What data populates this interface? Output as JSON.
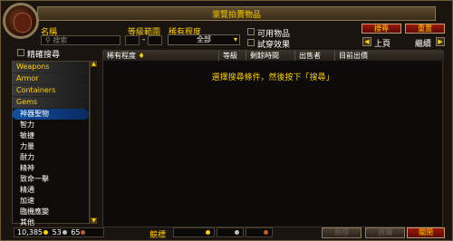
{
  "window": {
    "title": "瀏覽拍賣物品"
  },
  "filters": {
    "name_label": "名稱",
    "search_placeholder": "搜索",
    "level_label": "等級範圍",
    "level_dash": "-",
    "rarity_label": "稀有程度",
    "rarity_value": "全部",
    "usable_label": "可用物品",
    "preview_label": "試穿效果",
    "search_button": "搜尋",
    "reset_button": "重置",
    "prev_label": "上頁",
    "next_label": "繼續",
    "exact_label": "精確搜尋"
  },
  "categories": [
    {
      "label": "Weapons",
      "type": "top",
      "selected": false
    },
    {
      "label": "Armor",
      "type": "top",
      "selected": false
    },
    {
      "label": "Containers",
      "type": "top",
      "selected": false
    },
    {
      "label": "Gems",
      "type": "top",
      "selected": false
    },
    {
      "label": "神器聖物",
      "type": "sub",
      "selected": true
    },
    {
      "label": "智力",
      "type": "sub",
      "selected": false
    },
    {
      "label": "敏捷",
      "type": "sub",
      "selected": false
    },
    {
      "label": "力量",
      "type": "sub",
      "selected": false
    },
    {
      "label": "耐力",
      "type": "sub",
      "selected": false
    },
    {
      "label": "精神",
      "type": "sub",
      "selected": false
    },
    {
      "label": "致命一擊",
      "type": "sub",
      "selected": false
    },
    {
      "label": "精通",
      "type": "sub",
      "selected": false
    },
    {
      "label": "加速",
      "type": "sub",
      "selected": false
    },
    {
      "label": "臨機應變",
      "type": "sub",
      "selected": false
    },
    {
      "label": "其他",
      "type": "sub",
      "selected": false
    }
  ],
  "columns": {
    "rarity": "稀有程度",
    "level": "等級",
    "time_left": "剩餘時間",
    "seller": "出售者",
    "current_bid": "目前出價"
  },
  "message": "選擇搜尋條件，然後按下「搜尋」",
  "bottom": {
    "gold": "10,385",
    "silver": "53",
    "copper": "65",
    "bid_label": "競標",
    "bid_button": "競標",
    "buyout_button": "直購",
    "close_button": "關閉"
  },
  "colors": {
    "gold": "#ffd100",
    "silver": "#c0c0c0",
    "copper": "#c06030",
    "button_red": "#a01808"
  }
}
